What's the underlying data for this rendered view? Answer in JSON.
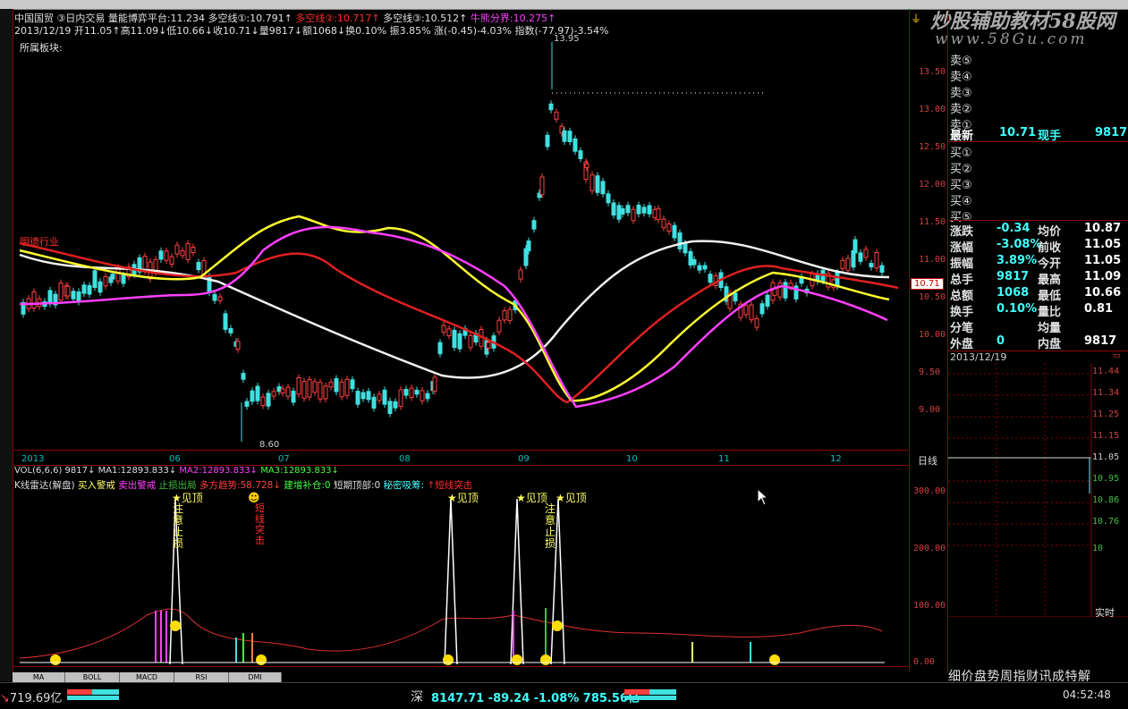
{
  "header": {
    "line1_prefix": "中国国贸  ③日内交易  量能博弈平台:11.234  多空线①:10.791↑",
    "line1_red1": "多空线②:10.717↑",
    "line1_mid": "多空线③:10.512↑",
    "line1_red2": "牛熊分界:10.275↑",
    "line2": "2013/12/19  开11.05↑高11.09↓低10.66↓收10.71↓量9817↓额1068↓换0.10% 振3.85% 涨(-0.45)-4.03% 指数(-77.97)-3.54%",
    "sector_label": "所属板块:",
    "left_tag": "明德行业"
  },
  "watermark": {
    "title": "炒股辅助教材58股网",
    "url": "www.58Gu.com"
  },
  "price_axis": [
    "13.50",
    "13.00",
    "12.50",
    "12.00",
    "11.50",
    "11.00",
    "10.50",
    "10.00",
    "9.50",
    "9.00"
  ],
  "price_high_label": "13.95",
  "price_low_label": "8.60",
  "current_price_tag": "10.71",
  "months": [
    "2013",
    "06",
    "07",
    "08",
    "09",
    "10",
    "11",
    "12"
  ],
  "period_label": "日线",
  "volume_line": {
    "prefix": "VOL(6,6,6) 9817↓",
    "ma1": "MA1:12893.833↓",
    "ma2": "MA2:12893.833↓",
    "ma3": "MA3:12893.833↓"
  },
  "indicator_line": {
    "name": "K线雷达(解盘)",
    "buy": "买入警戒",
    "sell": "卖出警戒",
    "stop": "止损出局",
    "bull": "多方趋势:58.728↓",
    "add": "建增补仓:0",
    "top": "短期顶部:0",
    "secret": "秘密吸筹:",
    "strike": "↑短线突击"
  },
  "indicator_axis": [
    "300.00",
    "200.00",
    "100.00",
    "0.00"
  ],
  "signals": {
    "top1": "见顶",
    "attention": "注意止损",
    "short_strike": "短线突击",
    "top2": "见顶",
    "top3": "见顶",
    "top4": "见顶"
  },
  "order_book": {
    "sell": [
      "卖⑤",
      "卖④",
      "卖③",
      "卖②",
      "卖①"
    ],
    "buy": [
      "买①",
      "买②",
      "买③",
      "买④",
      "买⑤"
    ],
    "latest_label": "最新",
    "latest_value": "10.71",
    "now_hand_label": "现手",
    "now_hand_value": "9817"
  },
  "stats": [
    {
      "l1": "涨跌",
      "v1": "-0.34",
      "l2": "均价",
      "v2": "10.87"
    },
    {
      "l1": "涨幅",
      "v1": "-3.08%",
      "l2": "前收",
      "v2": "11.05"
    },
    {
      "l1": "振幅",
      "v1": "3.89%",
      "l2": "今开",
      "v2": "11.05"
    },
    {
      "l1": "总手",
      "v1": "9817",
      "l2": "最高",
      "v2": "11.09"
    },
    {
      "l1": "总额",
      "v1": "1068",
      "l2": "最低",
      "v2": "10.66"
    },
    {
      "l1": "换手",
      "v1": "0.10%",
      "l2": "量比",
      "v2": "0.81"
    },
    {
      "l1": "分笔",
      "v1": "",
      "l2": "均量",
      "v2": ""
    },
    {
      "l1": "外盘",
      "v1": "0",
      "l2": "内盘",
      "v2": "9817"
    }
  ],
  "mini": {
    "date": "2013/12/19",
    "axis": [
      "11.44",
      "11.34",
      "11.25",
      "11.15",
      "11.05",
      "10.95",
      "10.86",
      "10.76",
      "10"
    ],
    "realtime": "实时",
    "footer": "细价盘势周指财讯成特解"
  },
  "tabs": [
    "MA",
    "BOLL",
    "MACD",
    "RSI",
    "DMI"
  ],
  "status": {
    "left_value": "719.69亿",
    "shen_label": "深",
    "shen_values": "8147.71  -89.24  -1.08%  785.56亿",
    "time": "04:52:48"
  }
}
